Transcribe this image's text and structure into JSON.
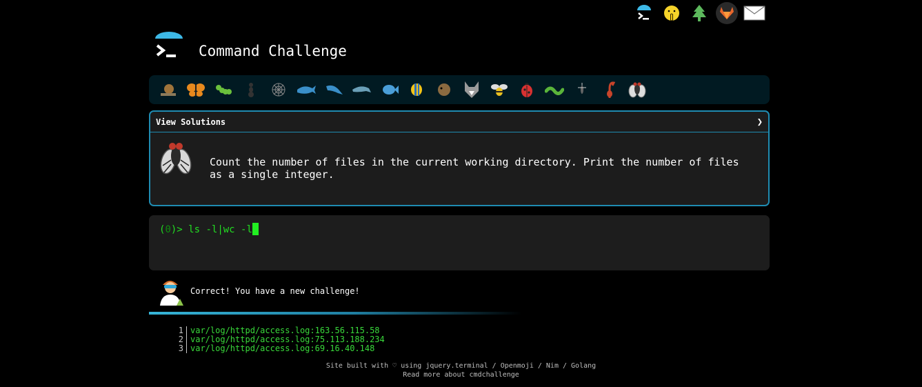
{
  "header": {
    "title": "Command Challenge",
    "top_icons": [
      "cmdchallenge-icon",
      "shushing-face-icon",
      "tree-icon",
      "gitlab-icon",
      "mail-icon"
    ]
  },
  "challenge_strip": {
    "icons": [
      "snail-icon",
      "butterfly-icon",
      "caterpillar-icon",
      "ant-icon",
      "spiderweb-icon",
      "whale-icon",
      "dolphin-icon",
      "dolphin-icon",
      "fish-icon",
      "tropical-fish-icon",
      "blowfish-icon",
      "wolf-icon",
      "bee-icon",
      "ladybug-icon",
      "worm-icon",
      "mosquito-icon",
      "scorpion-icon",
      "fly-icon"
    ]
  },
  "panel": {
    "header_label": "View Solutions",
    "toggle_glyph": "❯",
    "description": "Count the number of files in the current working directory. Print the number of files as a single integer.",
    "icon": "fly-icon"
  },
  "terminal": {
    "prompt_open": "(",
    "prompt_num": "0",
    "prompt_close": ")> ",
    "command": "ls -l|wc -l"
  },
  "result": {
    "message": "Correct! You have a new challenge!",
    "icon": "hacker-icon"
  },
  "output": {
    "lines": [
      {
        "n": "1",
        "text": "var/log/httpd/access.log:163.56.115.58"
      },
      {
        "n": "2",
        "text": "var/log/httpd/access.log:75.113.188.234"
      },
      {
        "n": "3",
        "text": "var/log/httpd/access.log:69.16.40.148"
      }
    ]
  },
  "footer": {
    "line1": "Site built with ♡ using jquery.terminal / Openmoji / Nim / Golang",
    "line2": "Read more about cmdchallenge"
  },
  "colors": {
    "accent": "#1f8cb2",
    "terminal_green": "#22dd22",
    "background": "#000000"
  }
}
